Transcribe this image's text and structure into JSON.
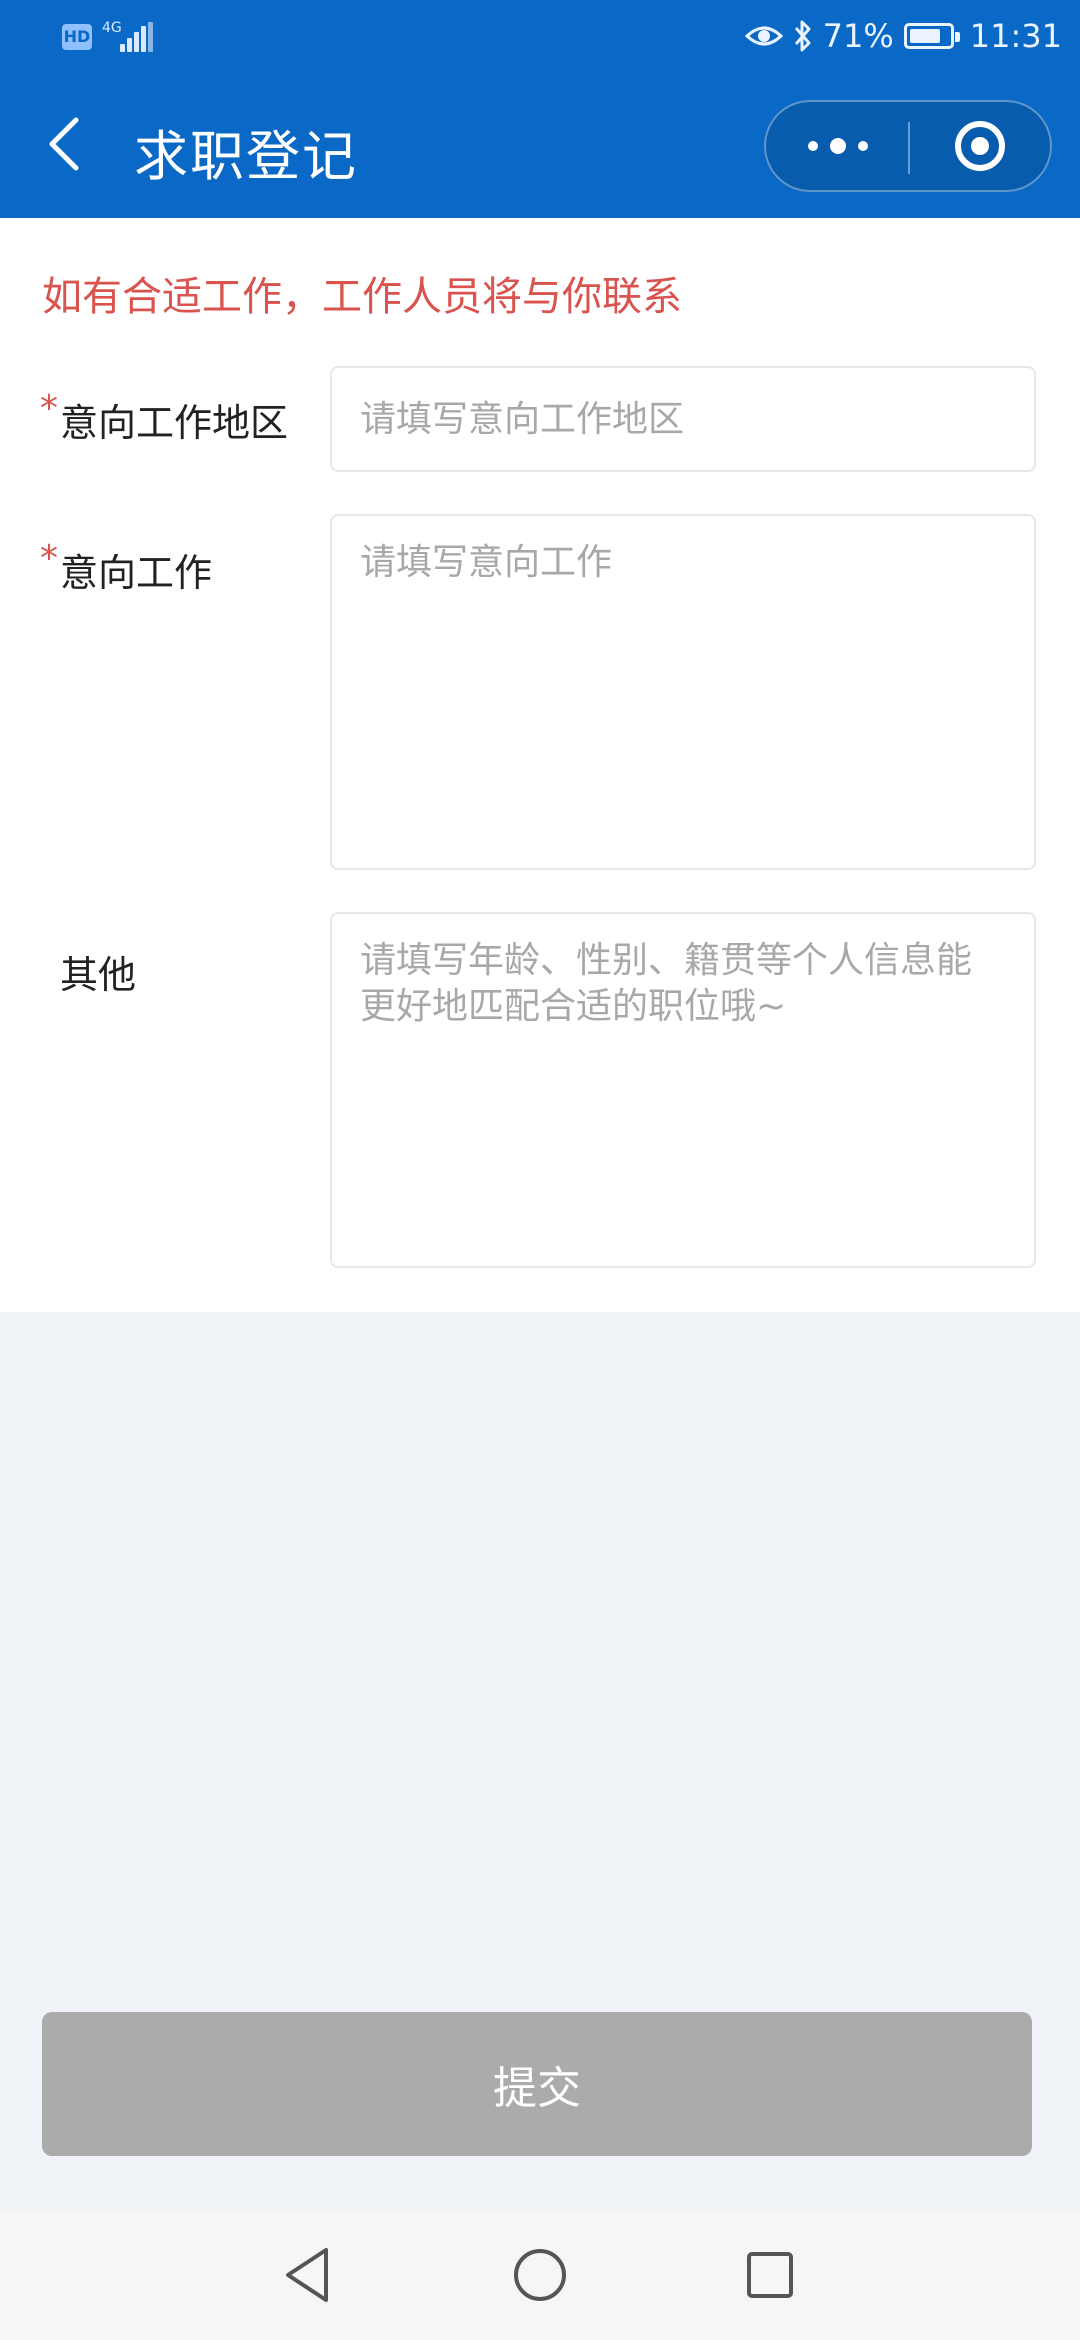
{
  "status_bar": {
    "hd": "HD",
    "network": "4G",
    "battery": "71%",
    "time": "11:31"
  },
  "header": {
    "title": "求职登记",
    "icons": [
      "back-chevron-icon",
      "more-dots-icon",
      "close-target-icon"
    ]
  },
  "form": {
    "notice": "如有合适工作，工作人员将与你联系",
    "required_mark": "*",
    "fields": [
      {
        "label": "意向工作地区",
        "placeholder": "请填写意向工作地区",
        "value": "",
        "required": true
      },
      {
        "label": "意向工作",
        "placeholder": "请填写意向工作",
        "value": "",
        "required": true
      },
      {
        "label": "其他",
        "placeholder": "请填写年龄、性别、籍贯等个人信息能更好地匹配合适的职位哦~",
        "value": "",
        "required": false
      }
    ]
  },
  "submit": {
    "label": "提交"
  },
  "colors": {
    "primary": "#0a69c6",
    "notice": "#d9534f",
    "button_disabled": "#ababab",
    "background": "#eff3f7"
  },
  "system_nav": [
    "back-triangle-icon",
    "home-circle-icon",
    "recents-square-icon"
  ]
}
